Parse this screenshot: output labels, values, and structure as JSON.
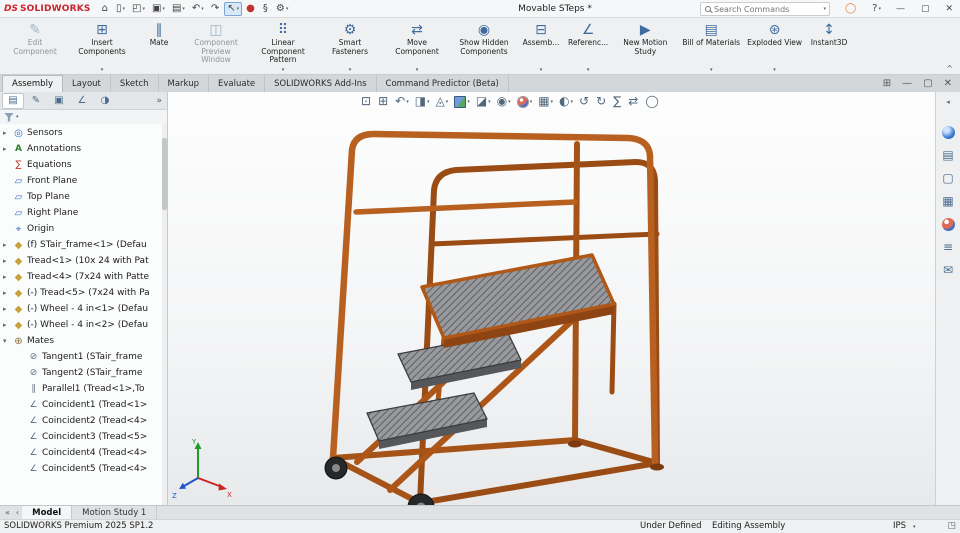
{
  "colors": {
    "accent": "#2a6fc9",
    "frame_orange": "#b55a1b",
    "frame_orange_dark": "#8f4413",
    "tread_gray": "#97999c",
    "logo_red": "#d2232a"
  },
  "titlebar": {
    "brand_prefix": "DS",
    "brand": "SOLIDWORKS",
    "doc_title": "Movable STeps *",
    "search_placeholder": "Search Commands",
    "search_caret": "▾",
    "menu_icons": [
      {
        "icon": "home"
      },
      {
        "icon": "new-document",
        "caret": "▾"
      },
      {
        "icon": "open",
        "caret": "▾"
      },
      {
        "icon": "save",
        "caret": "▾"
      },
      {
        "icon": "print",
        "caret": "▾"
      },
      {
        "icon": "undo",
        "caret": "▾"
      },
      {
        "icon": "redo"
      },
      {
        "icon": "select",
        "caret": "▾",
        "active": true
      },
      {
        "icon": "rebuild"
      },
      {
        "icon": "file-properties"
      },
      {
        "icon": "options",
        "caret": "▾"
      }
    ],
    "right_icons": [
      {
        "icon": "user"
      },
      {
        "icon": "help",
        "caret": "▾"
      }
    ],
    "window_icons": [
      {
        "icon": "minimize"
      },
      {
        "icon": "maximize"
      },
      {
        "icon": "close"
      }
    ]
  },
  "ribbon": {
    "collapse_icon": "^",
    "buttons": [
      {
        "label": "Edit Component",
        "icon": "edit-component",
        "disabled": true
      },
      {
        "label": "Insert Components",
        "icon": "insert-components",
        "caret": "▾"
      },
      {
        "label": "Mate",
        "icon": "mate"
      },
      {
        "label": "Component Preview Window",
        "icon": "component-preview-window",
        "disabled": true
      },
      {
        "label": "Linear Component Pattern",
        "icon": "linear-component-pattern",
        "caret": "▾"
      },
      {
        "label": "Smart Fasteners",
        "icon": "smart-fasteners",
        "caret": "▾"
      },
      {
        "label": "Move Component",
        "icon": "move-component",
        "caret": "▾"
      },
      {
        "label": "Show Hidden Components",
        "icon": "show-hidden-components"
      },
      {
        "label": "Assemb...",
        "icon": "assembly-features",
        "caret": "▾"
      },
      {
        "label": "Referenc...",
        "icon": "reference-geometry",
        "caret": "▾"
      },
      {
        "label": "New Motion Study",
        "icon": "new-motion-study"
      },
      {
        "label": "Bill of Materials",
        "icon": "bill-of-materials",
        "caret": "▾"
      },
      {
        "label": "Exploded View",
        "icon": "exploded-view",
        "caret": "▾"
      },
      {
        "label": "Instant3D",
        "icon": "instant3d"
      }
    ]
  },
  "ribbon_tabs": {
    "items": [
      {
        "label": "Assembly",
        "active": true
      },
      {
        "label": "Layout"
      },
      {
        "label": "Sketch"
      },
      {
        "label": "Markup"
      },
      {
        "label": "Evaluate"
      },
      {
        "label": "SOLIDWORKS Add-Ins"
      },
      {
        "label": "Command Predictor (Beta)"
      }
    ],
    "right_icons": [
      {
        "icon": "expand-panel"
      },
      {
        "icon": "minimize-doc"
      },
      {
        "icon": "restore-doc"
      },
      {
        "icon": "close-doc"
      }
    ]
  },
  "feature_panel": {
    "overflow_icon": "»",
    "filter_caret": "▾",
    "tabs": [
      {
        "icon": "feature-manager",
        "active": true
      },
      {
        "icon": "property-manager"
      },
      {
        "icon": "configuration-manager"
      },
      {
        "icon": "dimxpert-manager"
      },
      {
        "icon": "display-manager"
      }
    ],
    "tree": [
      {
        "label": "Sensors",
        "icon": "sensors",
        "arrow": "▸"
      },
      {
        "label": "Annotations",
        "icon": "annotations",
        "arrow": "▸"
      },
      {
        "label": "Equations",
        "icon": "equations"
      },
      {
        "label": "Front Plane",
        "icon": "plane"
      },
      {
        "label": "Top Plane",
        "icon": "plane"
      },
      {
        "label": "Right Plane",
        "icon": "plane"
      },
      {
        "label": "Origin",
        "icon": "origin"
      },
      {
        "label": "(f) STair_frame<1> (Defau",
        "icon": "component",
        "arrow": "▸"
      },
      {
        "label": "Tread<1> (10x 24 with Pat",
        "icon": "component",
        "arrow": "▸"
      },
      {
        "label": "Tread<4> (7x24 with Patte",
        "icon": "component",
        "arrow": "▸"
      },
      {
        "label": "(-) Tread<5> (7x24 with Pa",
        "icon": "component",
        "arrow": "▸"
      },
      {
        "label": "(-) Wheel - 4 in<1> (Defau",
        "icon": "component",
        "arrow": "▸"
      },
      {
        "label": "(-) Wheel - 4 in<2> (Defau",
        "icon": "component",
        "arrow": "▸"
      },
      {
        "label": "Mates",
        "icon": "mates",
        "arrow": "▾"
      },
      {
        "label": "Tangent1 (STair_frame",
        "icon": "tangent",
        "child": true
      },
      {
        "label": "Tangent2 (STair_frame",
        "icon": "tangent",
        "child": true
      },
      {
        "label": "Parallel1 (Tread<1>,To",
        "icon": "parallel",
        "child": true
      },
      {
        "label": "Coincident1 (Tread<1>",
        "icon": "coincident",
        "child": true
      },
      {
        "label": "Coincident2 (Tread<4>",
        "icon": "coincident",
        "child": true
      },
      {
        "label": "Coincident3 (Tread<5>",
        "icon": "coincident",
        "child": true
      },
      {
        "label": "Coincident4 (Tread<4>",
        "icon": "coincident",
        "child": true
      },
      {
        "label": "Coincident5 (Tread<4>",
        "icon": "coincident",
        "child": true
      }
    ]
  },
  "headsup": {
    "items": [
      {
        "icon": "zoom-to-fit"
      },
      {
        "icon": "zoom-to-area"
      },
      {
        "icon": "previous-view",
        "caret": "▾"
      },
      {
        "icon": "section-view",
        "caret": "▾"
      },
      {
        "icon": "dynamic-annotation-views",
        "caret": "▾"
      },
      {
        "icon": "view-orientation",
        "cube": true,
        "caret": "▾"
      },
      {
        "icon": "display-style",
        "caret": "▾"
      },
      {
        "icon": "hide-show-items",
        "caret": "▾"
      },
      {
        "icon": "edit-appearance",
        "ball": true,
        "caret": "▾"
      },
      {
        "icon": "apply-scene",
        "caret": "▾"
      },
      {
        "icon": "view-settings",
        "caret": "▾"
      },
      {
        "icon": "rotate-left"
      },
      {
        "icon": "rotate-right"
      },
      {
        "icon": "sigma"
      },
      {
        "icon": "pan"
      },
      {
        "icon": "sphere"
      }
    ]
  },
  "taskpane": {
    "collapse_icon": "◂",
    "items": [
      {
        "icon": "solidworks-resources",
        "blueball": true
      },
      {
        "icon": "design-library"
      },
      {
        "icon": "file-explorer"
      },
      {
        "icon": "view-palette"
      },
      {
        "icon": "appearances-scenes",
        "ball": true
      },
      {
        "icon": "custom-properties"
      },
      {
        "icon": "solidworks-forum"
      }
    ]
  },
  "graphics": {
    "triad": {
      "x_label": "X",
      "y_label": "Y",
      "z_label": "Z"
    }
  },
  "bottom_tabs": {
    "nav_icons": [
      {
        "icon": "tab-scroll-left"
      },
      {
        "icon": "tab-scroll-right"
      }
    ],
    "items": [
      {
        "label": "Model",
        "active": true
      },
      {
        "label": "Motion Study 1"
      }
    ]
  },
  "statusbar": {
    "product": "SOLIDWORKS Premium 2025 SP1.2",
    "define_status": "Under Defined",
    "mode": "Editing Assembly",
    "units": "IPS",
    "units_caret": "▾"
  },
  "icon_glyphs": {
    "home": "⌂",
    "new-document": "▯",
    "open": "◰",
    "save": "▣",
    "print": "▤",
    "undo": "↶",
    "redo": "↷",
    "select": "↖",
    "rebuild": "●",
    "file-properties": "§",
    "options": "⚙",
    "user": "◯",
    "help": "?",
    "minimize": "—",
    "maximize": "▢",
    "close": "✕",
    "edit-component": "✎",
    "insert-components": "⊞",
    "mate": "∥",
    "component-preview-window": "◫",
    "linear-component-pattern": "⠿",
    "smart-fasteners": "⚙",
    "move-component": "⇄",
    "show-hidden-components": "◉",
    "assembly-features": "⊟",
    "reference-geometry": "∠",
    "new-motion-study": "▶",
    "bill-of-materials": "▤",
    "exploded-view": "⊛",
    "instant3d": "↕",
    "expand-panel": "⊞",
    "minimize-doc": "—",
    "restore-doc": "▢",
    "close-doc": "✕",
    "feature-manager": "▤",
    "property-manager": "✎",
    "configuration-manager": "▣",
    "dimxpert-manager": "∠",
    "display-manager": "◑",
    "sensors": "◎",
    "annotations": "A",
    "equations": "∑",
    "plane": "▱",
    "origin": "⌖",
    "component": "◆",
    "mates": "⊕",
    "tangent": "⊘",
    "parallel": "∥",
    "coincident": "∠",
    "zoom-to-fit": "⊡",
    "zoom-to-area": "⊞",
    "previous-view": "↶",
    "section-view": "◨",
    "dynamic-annotation-views": "◬",
    "display-style": "◪",
    "hide-show-items": "◉",
    "apply-scene": "▦",
    "view-settings": "◐",
    "rotate-left": "↺",
    "rotate-right": "↻",
    "sigma": "∑",
    "pan": "⇄",
    "sphere": "◯",
    "design-library": "▤",
    "file-explorer": "▢",
    "view-palette": "▦",
    "custom-properties": "≡",
    "solidworks-forum": "✉",
    "tab-scroll-left": "«",
    "tab-scroll-right": "‹",
    "status-panel": "◳"
  }
}
